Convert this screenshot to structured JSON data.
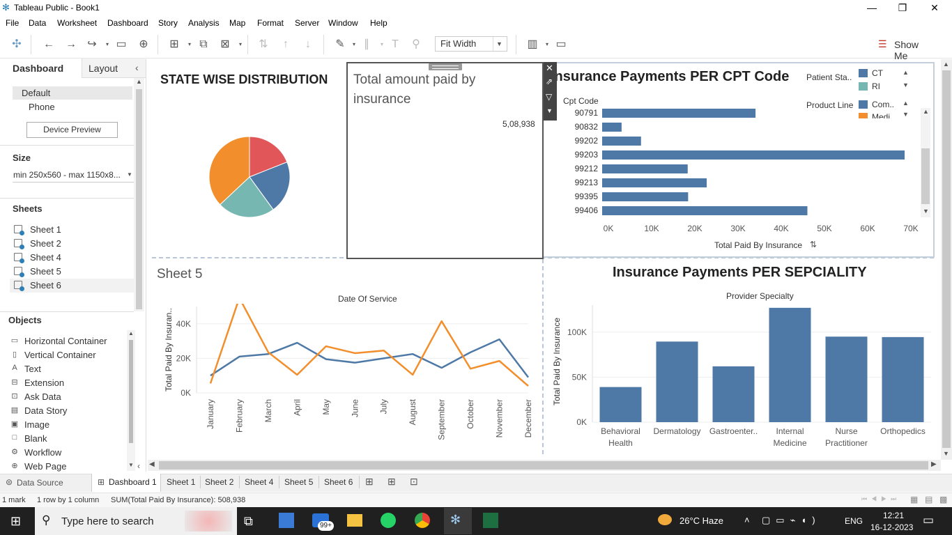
{
  "window": {
    "title": "Tableau Public - Book1"
  },
  "menu": [
    "File",
    "Data",
    "Worksheet",
    "Dashboard",
    "Story",
    "Analysis",
    "Map",
    "Format",
    "Server",
    "Window",
    "Help"
  ],
  "toolbar": {
    "fit_value": "Fit Width",
    "show_me": "Show Me"
  },
  "left_pane": {
    "tab_dashboard": "Dashboard",
    "tab_layout": "Layout",
    "devices": [
      "Default",
      "Phone"
    ],
    "device_preview": "Device Preview",
    "size_header": "Size",
    "size_value": "min 250x560 - max 1150x8...",
    "sheets_header": "Sheets",
    "sheets": [
      "Sheet 1",
      "Sheet 2",
      "Sheet 4",
      "Sheet 5",
      "Sheet 6"
    ],
    "objects_header": "Objects",
    "objects": [
      {
        "label": "Horizontal Container",
        "icon": "horizontal-container-icon",
        "glyph": "▭"
      },
      {
        "label": "Vertical Container",
        "icon": "vertical-container-icon",
        "glyph": "▯"
      },
      {
        "label": "Text",
        "icon": "text-icon",
        "glyph": "A"
      },
      {
        "label": "Extension",
        "icon": "extension-icon",
        "glyph": "⊟"
      },
      {
        "label": "Ask Data",
        "icon": "ask-data-icon",
        "glyph": "⊡"
      },
      {
        "label": "Data Story",
        "icon": "data-story-icon",
        "glyph": "▤"
      },
      {
        "label": "Image",
        "icon": "image-icon",
        "glyph": "▣"
      },
      {
        "label": "Blank",
        "icon": "blank-icon",
        "glyph": "□"
      },
      {
        "label": "Workflow",
        "icon": "workflow-icon",
        "glyph": "⚙"
      },
      {
        "label": "Web Page",
        "icon": "web-page-icon",
        "glyph": "⊕"
      }
    ]
  },
  "dashboard": {
    "state_title": "STATE WISE DISTRIBUTION",
    "total_title": "Total amount paid by insurance",
    "total_value": "5,08,938",
    "cpt_title": "Insurance Payments PER CPT Code",
    "cpt_col_header": "Cpt Code",
    "cpt_axis_title": "Total Paid By Insurance",
    "legend_patient_title": "Patient Sta..",
    "legend_patient_items": [
      "CT",
      "RI"
    ],
    "legend_product_title": "Product Line",
    "legend_product_items": [
      "Com..",
      "Medi.."
    ],
    "sheet5_title": "Sheet 5",
    "sheet5_header": "Date Of Service",
    "sheet5_ylabel": "Total Paid By Insuran..",
    "specialty_title": "Insurance Payments PER SEPCIALITY",
    "specialty_header": "Provider Specialty",
    "specialty_ylabel": "Total Paid By Insurance"
  },
  "chart_data": [
    {
      "type": "pie",
      "title": "STATE WISE DISTRIBUTION",
      "slices": [
        {
          "value": 0.19,
          "color": "#e15759"
        },
        {
          "value": 0.21,
          "color": "#4e79a7"
        },
        {
          "value": 0.23,
          "color": "#76b7b2"
        },
        {
          "value": 0.37,
          "color": "#f28e2b"
        }
      ]
    },
    {
      "type": "bar",
      "orientation": "horizontal",
      "title": "Insurance Payments PER CPT Code",
      "categories": [
        "90791",
        "90832",
        "99202",
        "99203",
        "99212",
        "99213",
        "99395",
        "99406"
      ],
      "values": [
        35500,
        4500,
        9000,
        70000,
        19800,
        24200,
        19900,
        47500
      ],
      "xlabel": "Total Paid By Insurance",
      "xlim": [
        0,
        70000
      ],
      "ticks": [
        "0K",
        "10K",
        "20K",
        "30K",
        "40K",
        "50K",
        "60K",
        "70K"
      ],
      "color": "#4e79a7"
    },
    {
      "type": "line",
      "title": "Sheet 5",
      "categories": [
        "January",
        "February",
        "March",
        "April",
        "May",
        "June",
        "July",
        "August",
        "September",
        "October",
        "November",
        "December"
      ],
      "ylabel": "Total Paid By Insuran..",
      "ylim": [
        0,
        50000
      ],
      "ticks": [
        "0K",
        "20K",
        "40K"
      ],
      "series": [
        {
          "values": [
            10000,
            21000,
            22500,
            29000,
            19500,
            17500,
            20000,
            22500,
            14500,
            23500,
            31000,
            9000
          ],
          "color": "#4e79a7"
        },
        {
          "values": [
            5500,
            55000,
            23500,
            10500,
            27000,
            23000,
            24500,
            10500,
            41500,
            14000,
            18500,
            4000
          ],
          "color": "#f28e2b"
        }
      ]
    },
    {
      "type": "bar",
      "title": "Insurance Payments PER SEPCIALITY",
      "categories": [
        "Behavioral\nHealth",
        "Dermatology",
        "Gastroenter..",
        "Internal\nMedicine",
        "Nurse\nPractitioner",
        "Orthopedics"
      ],
      "values": [
        39000,
        89500,
        62000,
        127000,
        95000,
        94500
      ],
      "ylabel": "Total Paid By Insurance",
      "ylim": [
        0,
        130000
      ],
      "ticks": [
        "0K",
        "50K",
        "100K"
      ],
      "color": "#4e79a7"
    }
  ],
  "footer_tabs": {
    "data_source": "Data Source",
    "active": "Dashboard 1",
    "sheets": [
      "Sheet 1",
      "Sheet 2",
      "Sheet 4",
      "Sheet 5",
      "Sheet 6"
    ]
  },
  "status": {
    "marks": "1 mark",
    "rows": "1 row by 1 column",
    "sum": "SUM(Total Paid By Insurance): 508,938"
  },
  "taskbar": {
    "search_placeholder": "Type here to search",
    "badge": "99+",
    "weather": "26°C  Haze",
    "lang": "ENG",
    "time": "12:21",
    "date": "16-12-2023"
  }
}
